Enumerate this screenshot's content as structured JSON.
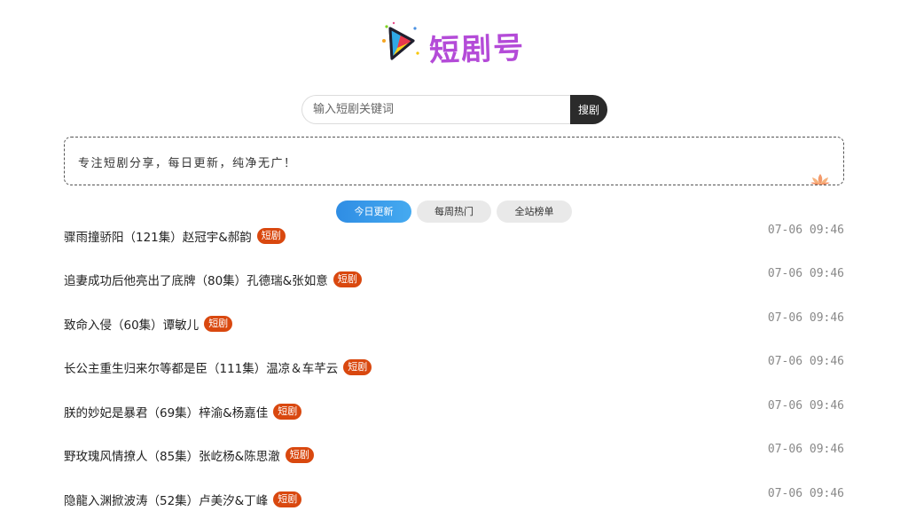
{
  "logo": {
    "text": "短剧号"
  },
  "search": {
    "placeholder": "输入短剧关键词",
    "button_label": "搜剧"
  },
  "notice": {
    "text": "专注短剧分享，每日更新，纯净无广！"
  },
  "tabs": [
    {
      "label": "今日更新",
      "active": true
    },
    {
      "label": "每周热门",
      "active": false
    },
    {
      "label": "全站榜单",
      "active": false
    }
  ],
  "items": [
    {
      "title": "骤雨撞骄阳（121集）赵冠宇&郝韵",
      "badge": "短剧",
      "time": "07-06 09:46"
    },
    {
      "title": "追妻成功后他亮出了底牌（80集）孔德瑞&张如意",
      "badge": "短剧",
      "time": "07-06 09:46"
    },
    {
      "title": "致命入侵（60集）谭敏儿",
      "badge": "短剧",
      "time": "07-06 09:46"
    },
    {
      "title": "长公主重生归来尔等都是臣（111集）温凉＆车芊云",
      "badge": "短剧",
      "time": "07-06 09:46"
    },
    {
      "title": "朕的妙妃是暴君（69集）梓渝&杨嘉佳",
      "badge": "短剧",
      "time": "07-06 09:46"
    },
    {
      "title": "野玫瑰风情撩人（85集）张屹杨&陈思澈",
      "badge": "短剧",
      "time": "07-06 09:46"
    },
    {
      "title": "隐龍入渊掀波涛（52集）卢美汐&丁峰",
      "badge": "短剧",
      "time": "07-06 09:46"
    }
  ],
  "colors": {
    "brand": "#b44bd8",
    "badge": "#d9480f",
    "tab_active": "#2f8de4",
    "search_button": "#2b2b2b"
  },
  "icons": {
    "logo_mark": "play-icon",
    "notice_decor": "lotus-icon"
  }
}
